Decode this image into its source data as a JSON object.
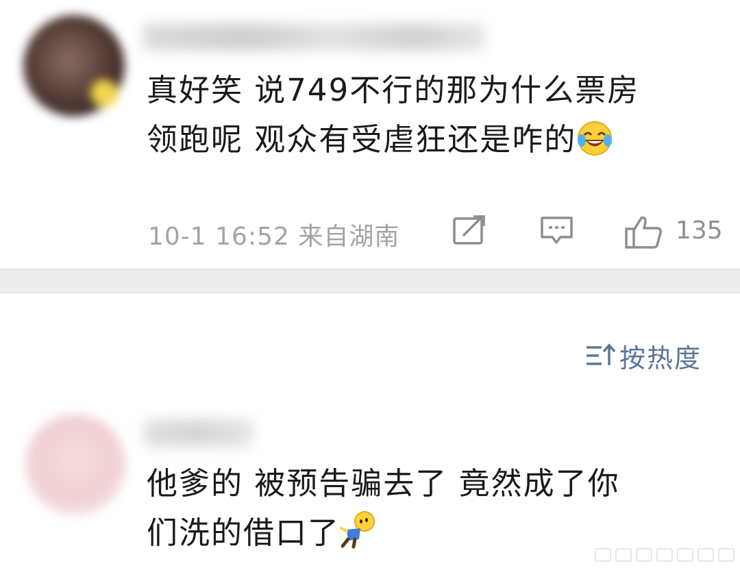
{
  "comments": [
    {
      "username": "",
      "text_line1": "真好笑 说749不行的那为什么票房",
      "text_line2": "领跑呢 观众有受虐狂还是咋的",
      "emoji": "laughing-crying-emoji",
      "time": "10-1 16:52 来自湖南",
      "like_count": "135"
    },
    {
      "username": "",
      "text_line1": "他爹的 被预告骗去了 竟然成了你",
      "text_line2": "们洗的借口了",
      "emoji": "doll-emoji"
    }
  ],
  "sort": {
    "label": "按热度",
    "icon": "sort-icon"
  },
  "icons": {
    "share": "share-icon",
    "reply": "comment-icon",
    "like": "thumbs-up-icon"
  },
  "colors": {
    "text": "#1a1a1a",
    "meta": "#a3a3a3",
    "sort": "#5a7694",
    "divider": "#ededed"
  }
}
